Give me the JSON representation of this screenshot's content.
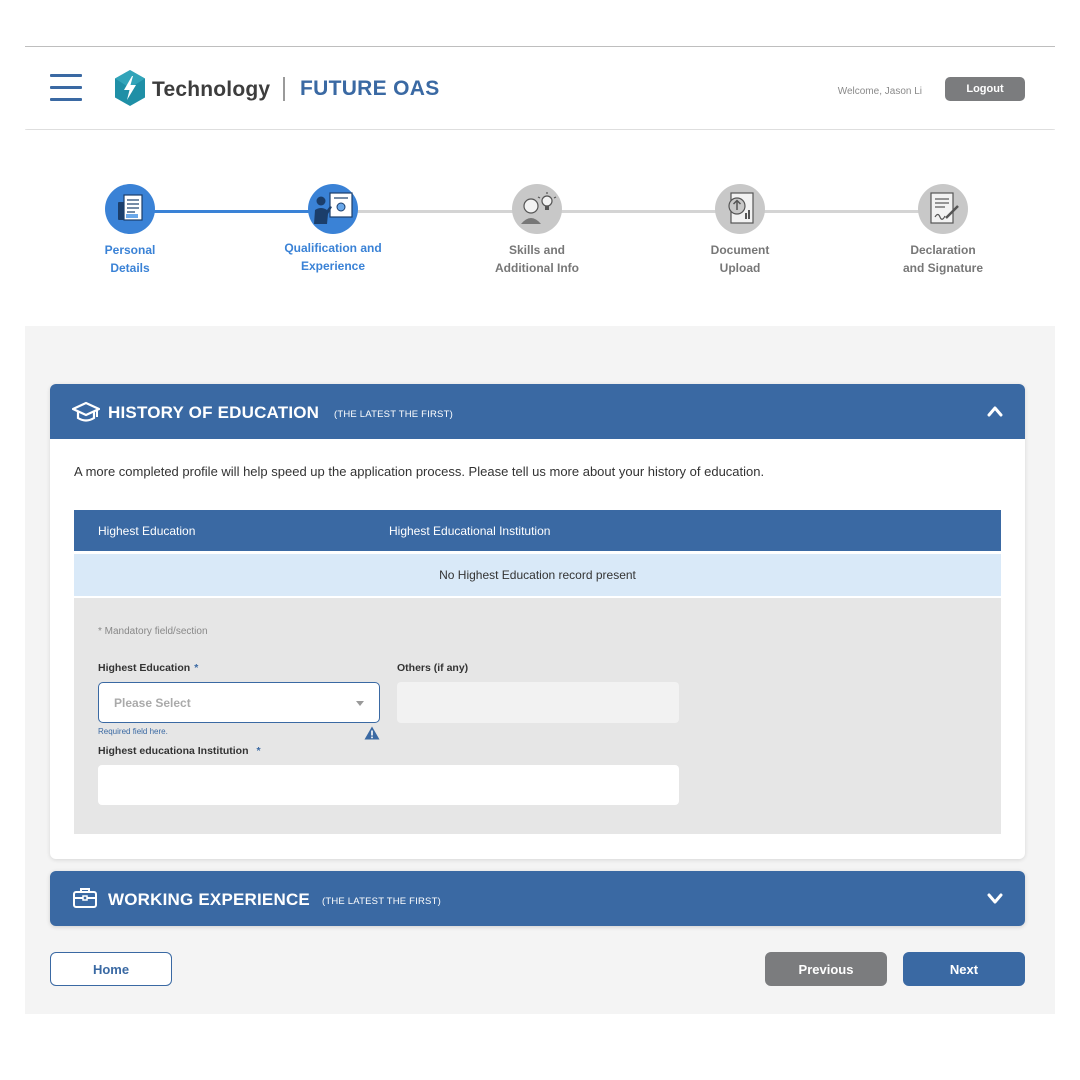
{
  "header": {
    "brand": "Technology",
    "product": "FUTURE OAS",
    "welcome": "Welcome, Jason Li",
    "logout_label": "Logout",
    "colors": {
      "primary": "#3a69a3",
      "logo_teal": "#1f8fa6"
    }
  },
  "stepper": {
    "steps": [
      {
        "label": "Personal\nDetails",
        "state": "completed",
        "icon": "document-icon"
      },
      {
        "label": "Qualification and\nExperience",
        "state": "current",
        "icon": "certificate-presenter-icon"
      },
      {
        "label": "Skills and\nAdditional Info",
        "state": "pending",
        "icon": "idea-person-icon"
      },
      {
        "label": "Document\nUpload",
        "state": "pending",
        "icon": "upload-document-icon"
      },
      {
        "label": "Declaration\nand Signature",
        "state": "pending",
        "icon": "signature-document-icon"
      }
    ],
    "colors": {
      "active": "#3a82d6",
      "inactive": "#c8c8c8"
    }
  },
  "education": {
    "title": "HISTORY OF EDUCATION",
    "subtitle": "(THE LATEST THE FIRST)",
    "intro": "A more completed profile will help speed up the application process. Please tell us more about your history of education.",
    "table_headers": [
      "Highest Education",
      "Highest Educational Institution"
    ],
    "empty_message": "No Highest Education record present",
    "mandatory_note": "* Mandatory field/section",
    "highest_education_label": "Highest Education",
    "required_mark": "*",
    "select_placeholder": "Please Select",
    "others_label": "Others (if any)",
    "error_text": "Required field here.",
    "institution_label": "Highest educationa Institution"
  },
  "working": {
    "title": "WORKING EXPERIENCE",
    "subtitle": "(THE LATEST THE FIRST)"
  },
  "nav": {
    "home": "Home",
    "previous": "Previous",
    "next": "Next"
  }
}
